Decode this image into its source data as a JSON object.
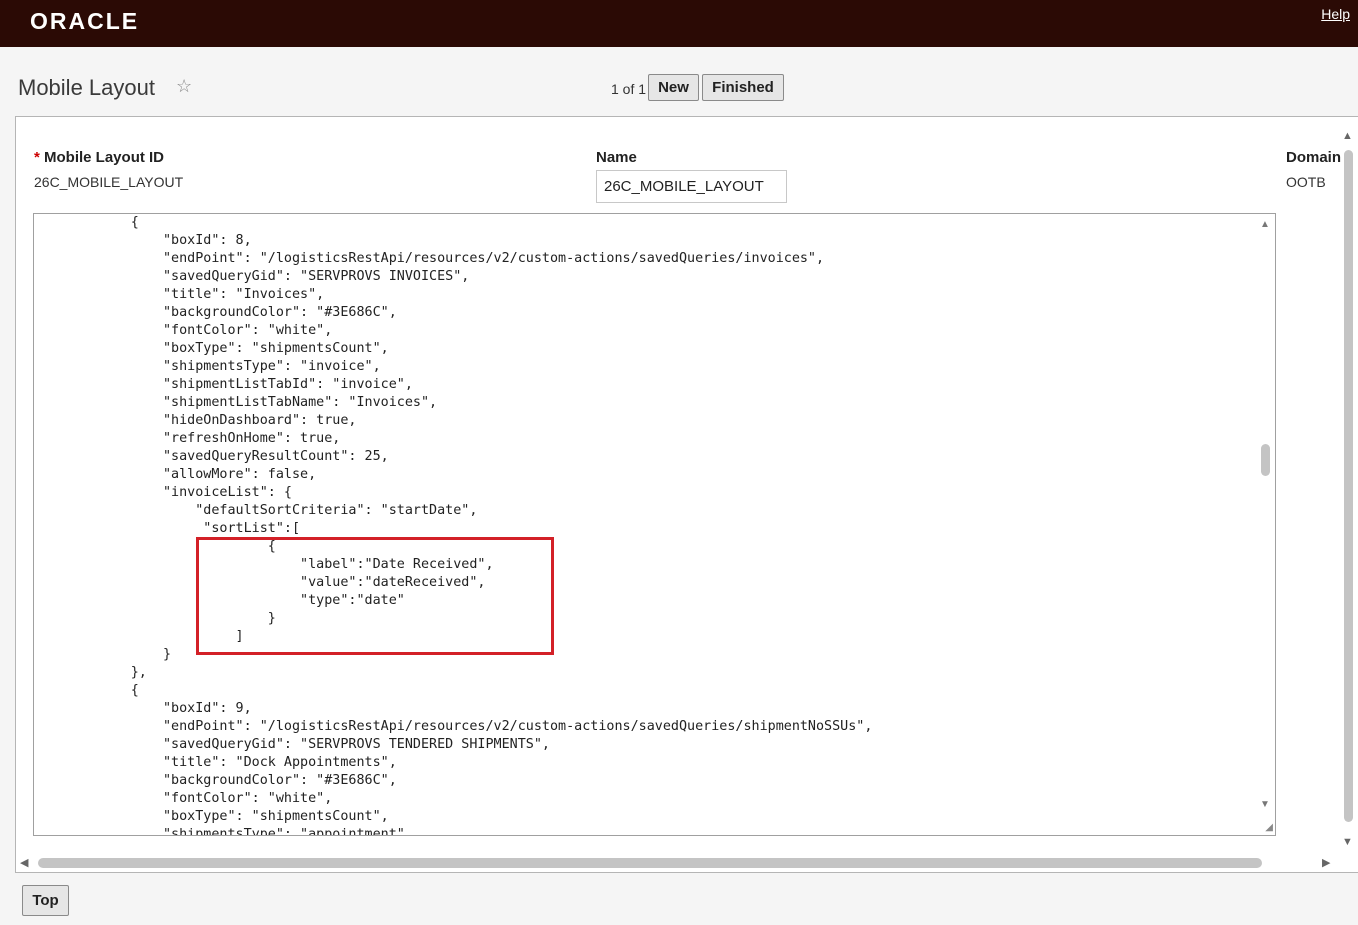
{
  "header": {
    "logo": "ORACLE",
    "help_link": "Help"
  },
  "page": {
    "title": "Mobile Layout",
    "star_icon": "star-icon",
    "page_count": "1 of 1",
    "new_button": "New",
    "finished_button": "Finished",
    "top_button": "Top"
  },
  "fields": {
    "mobile_layout_id": {
      "required_mark": "*",
      "label": "Mobile Layout ID",
      "value": "26C_MOBILE_LAYOUT"
    },
    "name": {
      "label": "Name",
      "value": "26C_MOBILE_LAYOUT"
    },
    "domain": {
      "label": "Domain",
      "value": "OOTB"
    }
  },
  "code_editor": {
    "lines": [
      "            {",
      "                \"boxId\": 8,",
      "                \"endPoint\": \"/logisticsRestApi/resources/v2/custom-actions/savedQueries/invoices\",",
      "                \"savedQueryGid\": \"SERVPROVS INVOICES\",",
      "                \"title\": \"Invoices\",",
      "                \"backgroundColor\": \"#3E686C\",",
      "                \"fontColor\": \"white\",",
      "                \"boxType\": \"shipmentsCount\",",
      "                \"shipmentsType\": \"invoice\",",
      "                \"shipmentListTabId\": \"invoice\",",
      "                \"shipmentListTabName\": \"Invoices\",",
      "                \"hideOnDashboard\": true,",
      "                \"refreshOnHome\": true,",
      "                \"savedQueryResultCount\": 25,",
      "                \"allowMore\": false,",
      "                \"invoiceList\": {",
      "                    \"defaultSortCriteria\": \"startDate\",",
      "                     \"sortList\":[",
      "                             {",
      "                                 \"label\":\"Date Received\",",
      "                                 \"value\":\"dateReceived\",",
      "                                 \"type\":\"date\"",
      "                             }",
      "                         ]",
      "                }",
      "            },",
      "            {",
      "                \"boxId\": 9,",
      "                \"endPoint\": \"/logisticsRestApi/resources/v2/custom-actions/savedQueries/shipmentNoSSUs\",",
      "                \"savedQueryGid\": \"SERVPROVS TENDERED SHIPMENTS\",",
      "                \"title\": \"Dock Appointments\",",
      "                \"backgroundColor\": \"#3E686C\",",
      "                \"fontColor\": \"white\",",
      "                \"boxType\": \"shipmentsCount\",",
      "                \"shipmentsType\": \"appointment\","
    ]
  },
  "colors": {
    "header_bg": "#2b0a05",
    "highlight": "#d32027",
    "required": "#cc0000"
  }
}
